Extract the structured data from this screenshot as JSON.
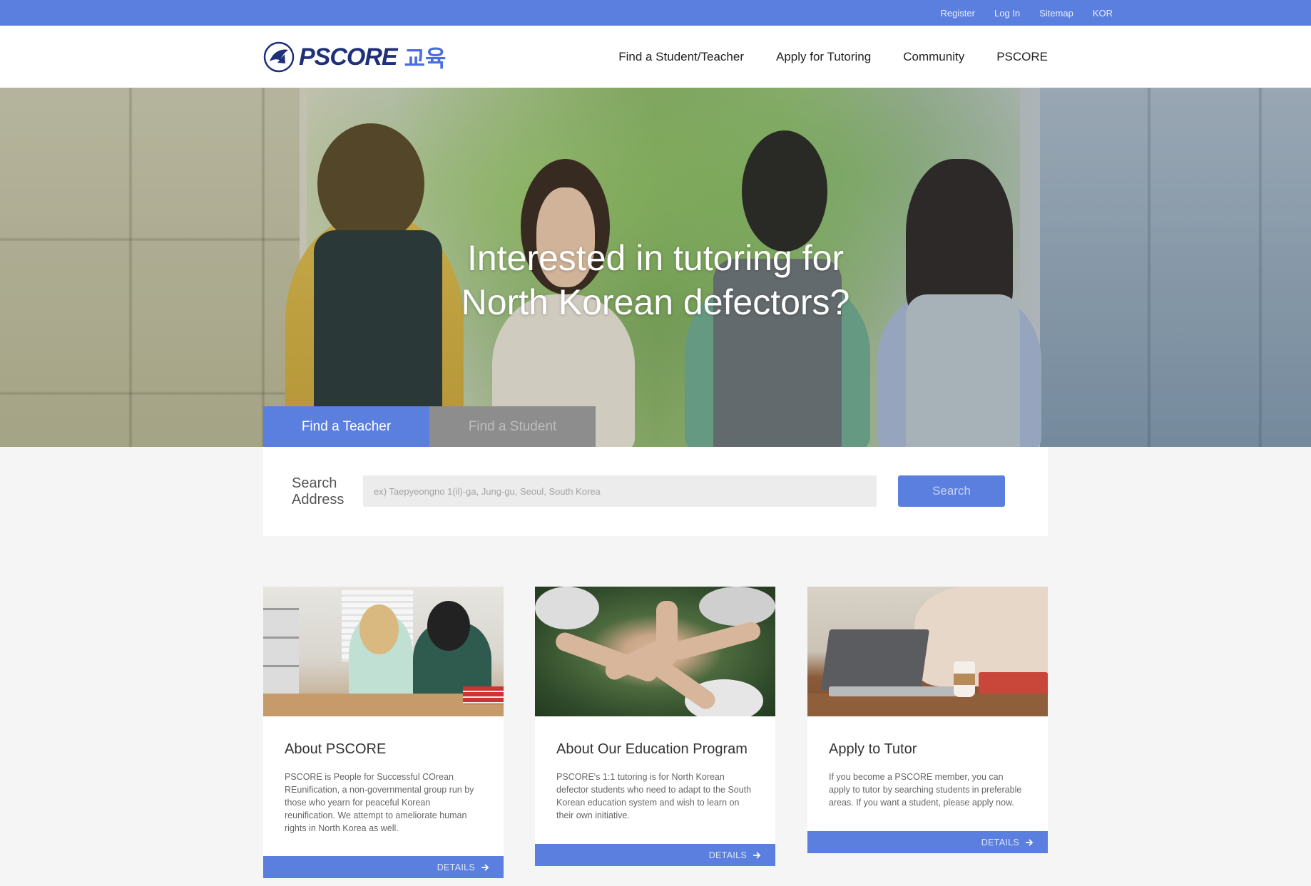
{
  "topbar": {
    "register": "Register",
    "login": "Log In",
    "sitemap": "Sitemap",
    "language": "KOR"
  },
  "logo": {
    "brand": "PSCORE",
    "korean": "교육"
  },
  "nav": {
    "items": [
      {
        "label": "Find a Student/Teacher"
      },
      {
        "label": "Apply for Tutoring"
      },
      {
        "label": "Community"
      },
      {
        "label": "PSCORE"
      }
    ]
  },
  "hero": {
    "headline_line1": "Interested in tutoring for",
    "headline_line2": "North Korean defectors?"
  },
  "tabs": {
    "find_teacher": "Find a Teacher",
    "find_student": "Find a Student",
    "active": "Find a Teacher"
  },
  "search": {
    "label_line1": "Search",
    "label_line2": "Address",
    "placeholder": "ex) Taepyeongno 1(il)-ga, Jung-gu, Seoul, South Korea",
    "button": "Search"
  },
  "cards": [
    {
      "title": "About PSCORE",
      "body": "PSCORE is People for Successful COrean REunification, a non-governmental group run by those who yearn for peaceful Korean reunification. We attempt to ameliorate human rights in North Korea as well.",
      "cta": "DETAILS"
    },
    {
      "title": "About Our Education Program",
      "body": "PSCORE's 1:1 tutoring is for North Korean defector students who need to adapt to the South Korean education system and wish to learn on their own initiative.",
      "cta": "DETAILS"
    },
    {
      "title": "Apply to Tutor",
      "body": "If you become a PSCORE member, you can apply to tutor by searching students in preferable areas. If you want a student, please apply now.",
      "cta": "DETAILS"
    }
  ],
  "colors": {
    "accent": "#5b7fde",
    "brand_dark": "#1f2f7a",
    "tab_inactive": "#8d8d8d"
  }
}
